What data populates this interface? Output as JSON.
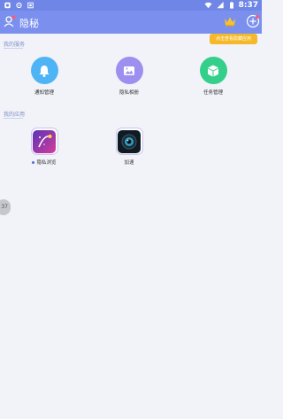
{
  "status_bar": {
    "time": "8:37",
    "left_icons": [
      "android-icon",
      "gear-icon",
      "notification-icon"
    ],
    "right_icons": [
      "wifi-icon",
      "signal-icon",
      "battery-icon"
    ]
  },
  "header": {
    "title": "隐秘",
    "tooltip": "点击查看隐藏应用"
  },
  "services": {
    "title": "我的服务",
    "items": [
      {
        "label": "通知管理",
        "icon": "bell-icon",
        "color": "#4fb4f5"
      },
      {
        "label": "隐私相册",
        "icon": "image-icon",
        "color": "#9b8ff0"
      },
      {
        "label": "任务管理",
        "icon": "cube-icon",
        "color": "#34cf8a"
      }
    ]
  },
  "apps": {
    "title": "我的应用",
    "items": [
      {
        "label": "隐私浏览",
        "icon": "browser-icon"
      },
      {
        "label": "加速",
        "icon": "camera-lens-icon"
      }
    ]
  },
  "side_tab": {
    "label": "37"
  }
}
